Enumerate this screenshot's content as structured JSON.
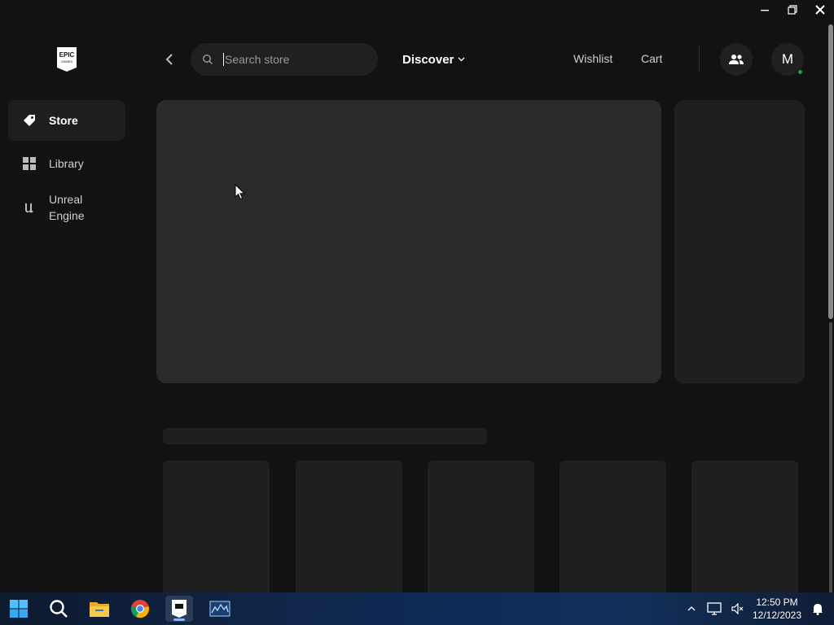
{
  "window": {
    "minimize_icon": "minimize-icon",
    "restore_icon": "restore-icon",
    "close_icon": "close-icon"
  },
  "topbar": {
    "logo_text_top": "EPIC",
    "logo_text_bottom": "GAMES",
    "search": {
      "placeholder": "Search store",
      "value": ""
    },
    "discover_label": "Discover",
    "wishlist_label": "Wishlist",
    "cart_label": "Cart",
    "avatar_initial": "M"
  },
  "sidebar": {
    "items": [
      {
        "label": "Store",
        "icon": "tag-icon",
        "active": true
      },
      {
        "label": "Library",
        "icon": "grid-icon",
        "active": false
      },
      {
        "label": "Unreal Engine",
        "icon": "unreal-icon",
        "active": false
      }
    ]
  },
  "taskbar": {
    "apps": [
      "windows-start-icon",
      "search-icon",
      "file-explorer-icon",
      "chrome-icon",
      "epic-games-icon",
      "monitor-app-icon"
    ],
    "clock_time": "12:50 PM",
    "clock_date": "12/12/2023"
  },
  "colors": {
    "background": "#121212",
    "skeleton": "#2a2a2a",
    "skeleton_dark": "#1f1f1f",
    "online": "#1ba14a"
  }
}
